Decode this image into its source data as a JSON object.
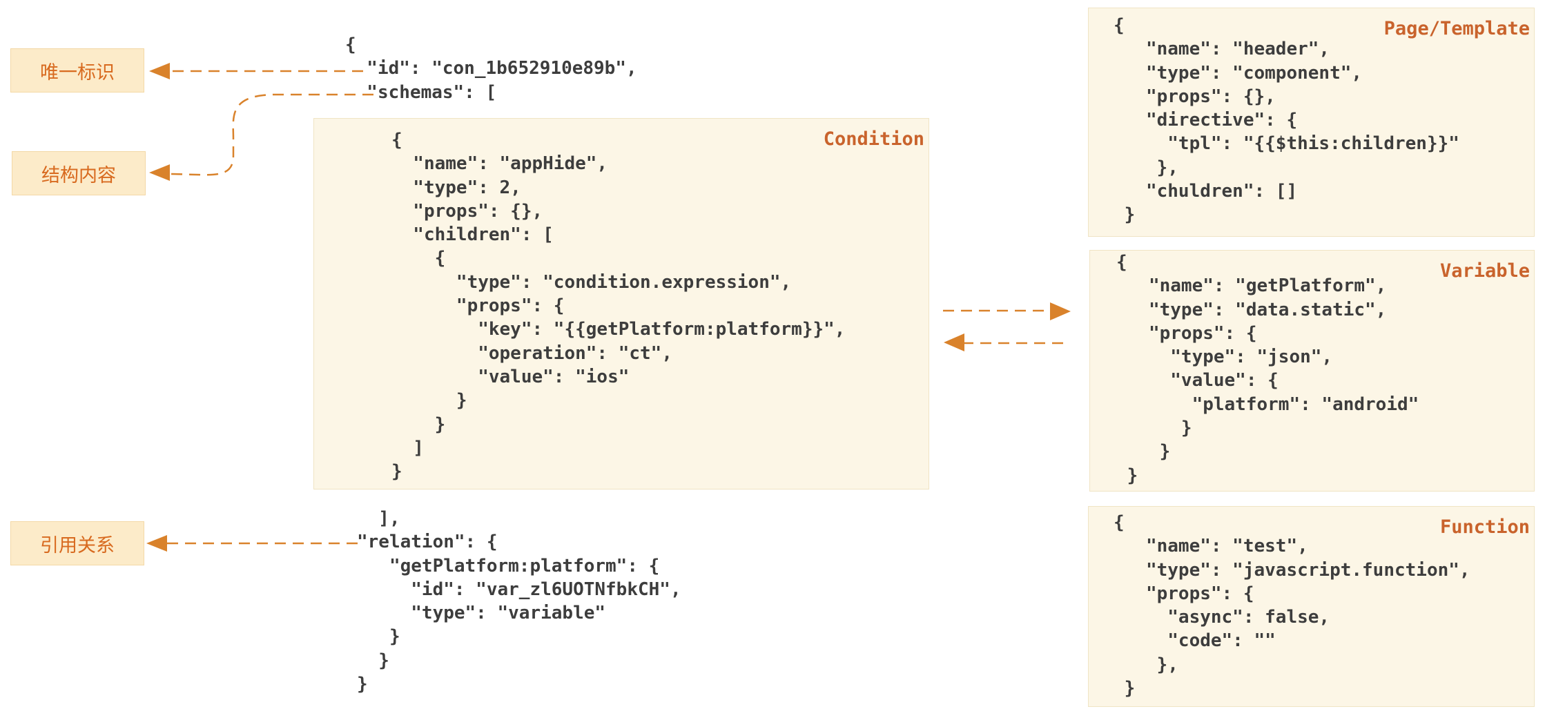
{
  "labels": {
    "unique_id": "唯一标识",
    "structure": "结构内容",
    "reference": "引用关系"
  },
  "main_code": {
    "top": "{\n  \"id\": \"con_1b652910e89b\",\n  \"schemas\": [",
    "bottom": "  ],\n\"relation\": {\n   \"getPlatform:platform\": {\n     \"id\": \"var_zl6UOTNfbkCH\",\n     \"type\": \"variable\"\n   }\n  }\n}"
  },
  "boxes": {
    "condition": {
      "title": "Condition",
      "code": "{\n  \"name\": \"appHide\",\n  \"type\": 2,\n  \"props\": {},\n  \"children\": [\n    {\n      \"type\": \"condition.expression\",\n      \"props\": {\n        \"key\": \"{{getPlatform:platform}}\",\n        \"operation\": \"ct\",\n        \"value\": \"ios\"\n      }\n    }\n  ]\n}"
    },
    "page_template": {
      "title": "Page/Template",
      "code": "{\n   \"name\": \"header\",\n   \"type\": \"component\",\n   \"props\": {},\n   \"directive\": {\n     \"tpl\": \"{{$this:children}}\"\n    },\n   \"chuldren\": []\n }"
    },
    "variable": {
      "title": "Variable",
      "code": "{\n   \"name\": \"getPlatform\",\n   \"type\": \"data.static\",\n   \"props\": {\n     \"type\": \"json\",\n     \"value\": {\n       \"platform\": \"android\"\n      }\n    }\n }"
    },
    "function": {
      "title": "Function",
      "code": "{\n   \"name\": \"test\",\n   \"type\": \"javascript.function\",\n   \"props\": {\n     \"async\": false,\n     \"code\": \"\"\n    },\n }"
    }
  },
  "colors": {
    "arrow": "#d9822b",
    "box_fill": "#fcf6e6",
    "tag_fill": "#fcebc9",
    "title_text": "#c9632c"
  }
}
